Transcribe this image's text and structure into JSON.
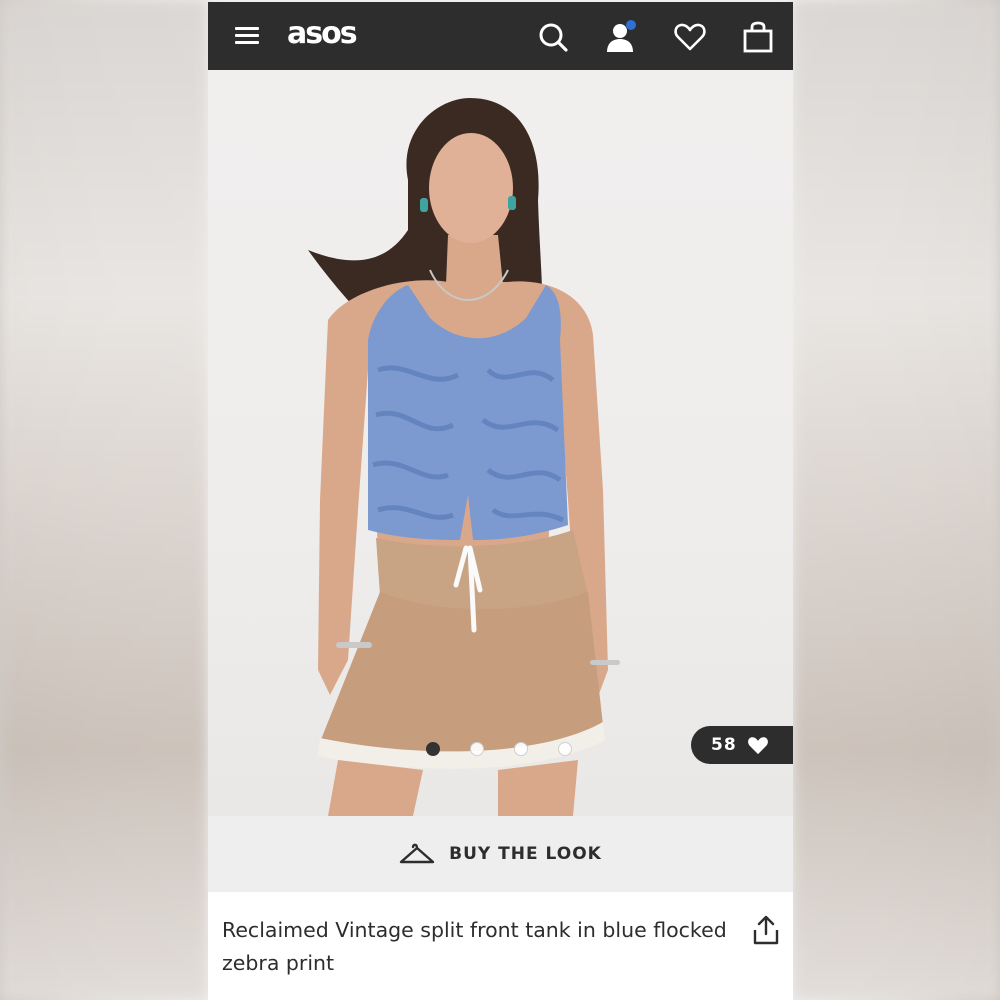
{
  "header": {
    "logo": "asos",
    "icons": [
      "menu-icon",
      "search-icon",
      "account-icon",
      "heart-icon",
      "bag-icon"
    ],
    "account_badge_color": "#2f6fd6",
    "background": "#2d2d2d"
  },
  "gallery": {
    "image_count": 4,
    "active_index": 0,
    "saves_count": "58"
  },
  "buy_the_look": {
    "label": "BUY THE LOOK",
    "icon": "hanger-icon"
  },
  "product": {
    "title": "Reclaimed Vintage split front tank in blue flocked zebra print",
    "share_icon": "share-icon"
  }
}
